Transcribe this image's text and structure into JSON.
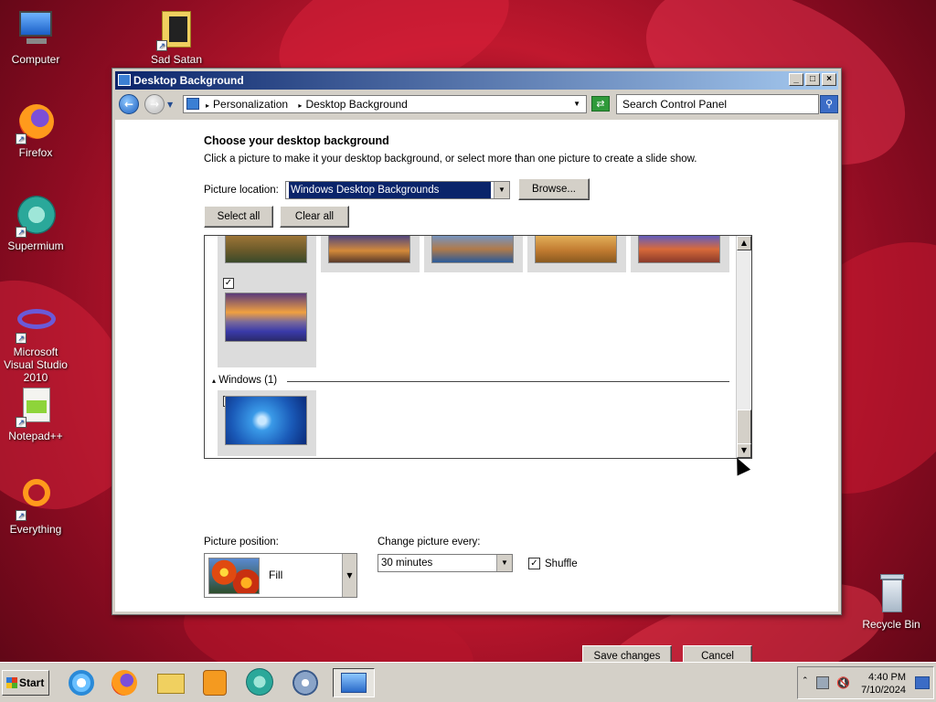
{
  "desktop": {
    "icons": [
      {
        "label": "Computer"
      },
      {
        "label": "Sad Satan"
      },
      {
        "label": "Firefox"
      },
      {
        "label": "Supermium"
      },
      {
        "label": "Microsoft Visual Studio 2010"
      },
      {
        "label": "Notepad++"
      },
      {
        "label": "Everything"
      },
      {
        "label": "Recycle Bin"
      }
    ]
  },
  "window": {
    "title": "Desktop Background",
    "breadcrumbs": [
      "Personalization",
      "Desktop Background"
    ],
    "search_placeholder": "Search Control Panel",
    "heading": "Choose your desktop background",
    "subheading": "Click a picture to make it your desktop background, or select more than one picture to create a slide show.",
    "picture_location_label": "Picture location:",
    "picture_location_value": "Windows Desktop Backgrounds",
    "browse_label": "Browse...",
    "select_all_label": "Select all",
    "clear_all_label": "Clear all",
    "group_windows_label": "Windows (1)",
    "picture_position_label": "Picture position:",
    "picture_position_value": "Fill",
    "change_every_label": "Change picture every:",
    "change_every_value": "30 minutes",
    "shuffle_label": "Shuffle",
    "save_label": "Save changes",
    "cancel_label": "Cancel"
  },
  "taskbar": {
    "start_label": "Start",
    "time": "4:40 PM",
    "date": "7/10/2024"
  }
}
